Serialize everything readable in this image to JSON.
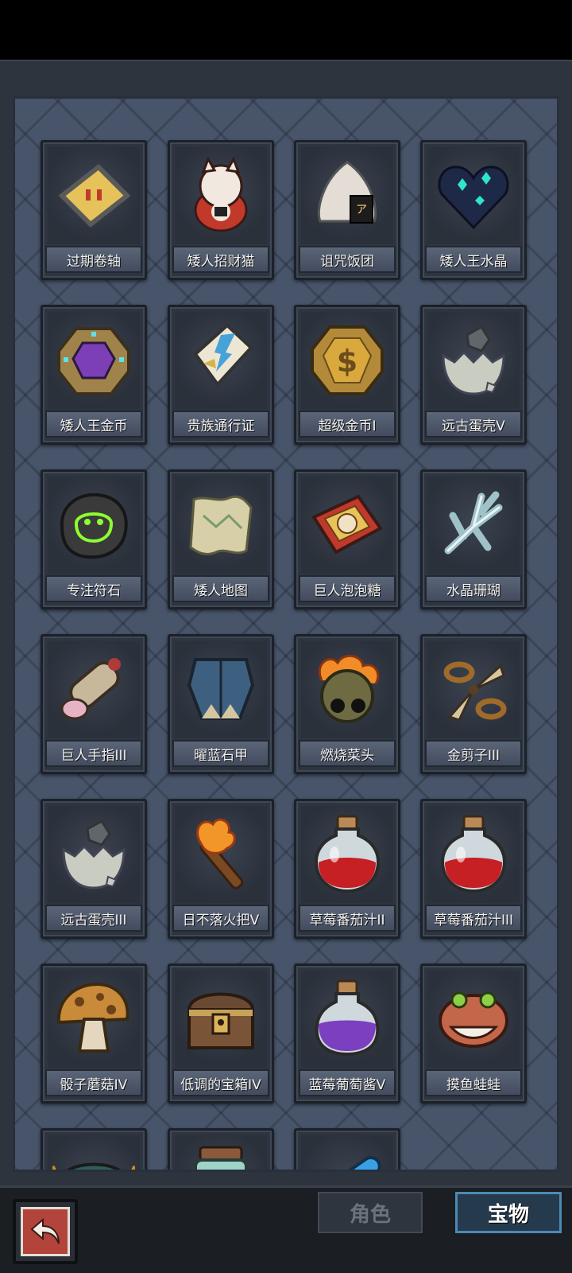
{
  "tabs": {
    "role": "角色",
    "treasure": "宝物"
  },
  "items": [
    {
      "name": "过期卷轴",
      "icon": "scroll-icon"
    },
    {
      "name": "矮人招财猫",
      "icon": "lucky-cat-icon"
    },
    {
      "name": "诅咒饭团",
      "icon": "rice-ball-icon"
    },
    {
      "name": "矮人王水晶",
      "icon": "crystal-heart-icon"
    },
    {
      "name": "矮人王金币",
      "icon": "gem-coin-icon"
    },
    {
      "name": "贵族通行证",
      "icon": "pass-card-icon"
    },
    {
      "name": "超级金币I",
      "icon": "gold-coin-icon"
    },
    {
      "name": "远古蛋壳V",
      "icon": "eggshell-icon"
    },
    {
      "name": "专注符石",
      "icon": "rune-stone-icon"
    },
    {
      "name": "矮人地图",
      "icon": "map-icon"
    },
    {
      "name": "巨人泡泡糖",
      "icon": "gum-pack-icon"
    },
    {
      "name": "水晶珊瑚",
      "icon": "coral-icon"
    },
    {
      "name": "巨人手指III",
      "icon": "giant-finger-icon"
    },
    {
      "name": "曜蓝石甲",
      "icon": "armor-icon"
    },
    {
      "name": "燃烧菜头",
      "icon": "burning-head-icon"
    },
    {
      "name": "金剪子III",
      "icon": "scissors-icon"
    },
    {
      "name": "远古蛋壳III",
      "icon": "eggshell-icon"
    },
    {
      "name": "日不落火把V",
      "icon": "torch-icon"
    },
    {
      "name": "草莓番茄汁II",
      "icon": "red-potion-icon"
    },
    {
      "name": "草莓番茄汁III",
      "icon": "red-potion-icon"
    },
    {
      "name": "骰子蘑菇IV",
      "icon": "mushroom-icon"
    },
    {
      "name": "低调的宝箱IV",
      "icon": "treasure-chest-icon"
    },
    {
      "name": "蓝莓葡萄酱V",
      "icon": "purple-potion-icon"
    },
    {
      "name": "摸鱼蛙蛙",
      "icon": "frog-icon"
    },
    {
      "name": "",
      "icon": "mask-icon"
    },
    {
      "name": "",
      "icon": "jar-icon"
    },
    {
      "name": "",
      "icon": "blue-crystal-icon"
    }
  ]
}
